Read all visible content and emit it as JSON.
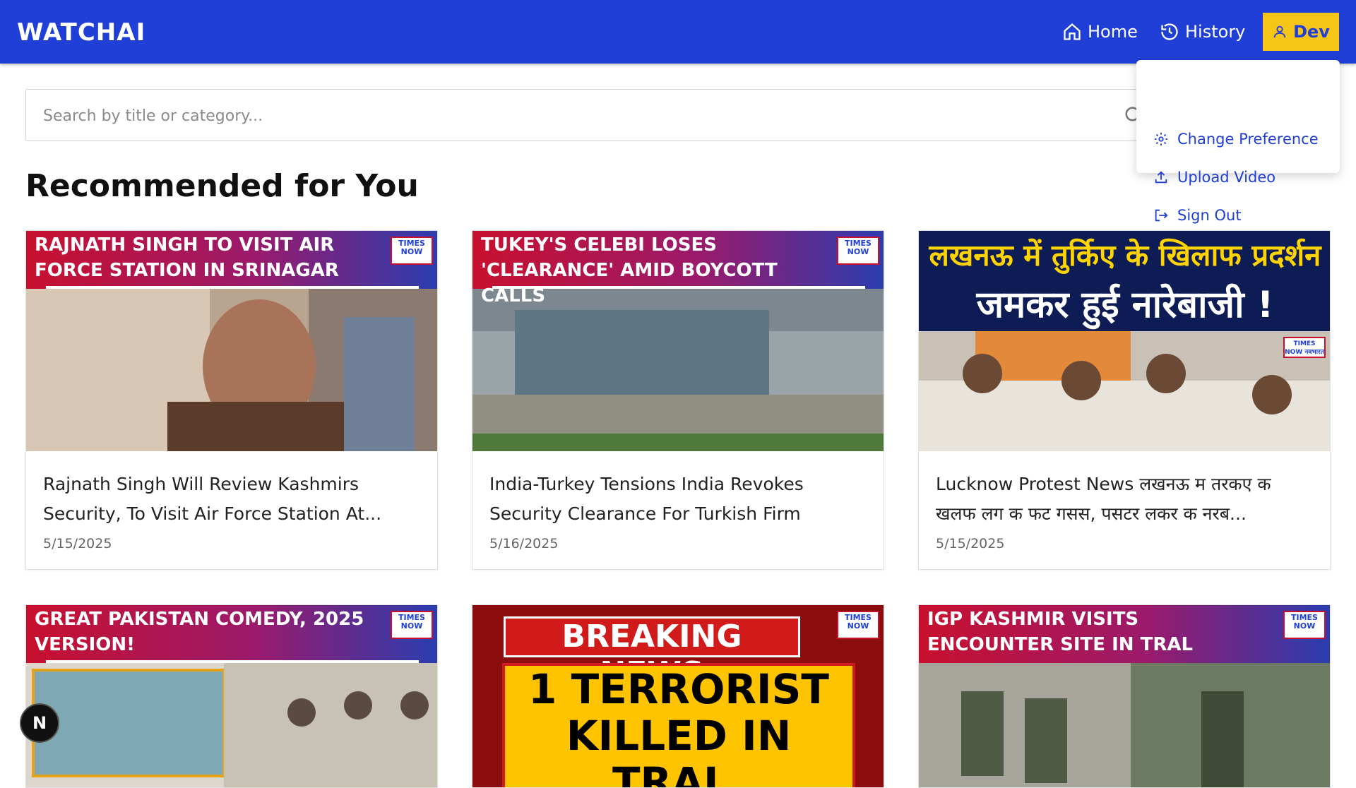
{
  "app": {
    "title": "WATCHAI"
  },
  "nav": {
    "home": "Home",
    "history": "History",
    "user": "Dev"
  },
  "user_menu": {
    "items": [
      {
        "label": "Change Preference",
        "icon": "gear-icon"
      },
      {
        "label": "Upload Video",
        "icon": "upload-icon"
      },
      {
        "label": "Sign Out",
        "icon": "sign-out-icon"
      }
    ]
  },
  "search": {
    "placeholder": "Search by title or category...",
    "value": ""
  },
  "section": {
    "title": "Recommended for You"
  },
  "videos": [
    {
      "thumb_headline": "RAJNATH SINGH TO VISIT AIR FORCE STATION IN SRINAGAR",
      "channel_badge": "TIMES NOW",
      "title": "Rajnath Singh Will Review Kashmirs Security, To Visit Air Force Station At...",
      "date": "5/15/2025"
    },
    {
      "thumb_headline": "TUKEY'S CELEBI LOSES 'CLEARANCE' AMID BOYCOTT CALLS",
      "channel_badge": "TIMES NOW",
      "title": "India-Turkey Tensions India Revokes Security Clearance For Turkish Firm Celebi...",
      "date": "5/16/2025"
    },
    {
      "thumb_headline_line1": "लखनऊ में तुर्किए के खिलाफ प्रदर्शन",
      "thumb_headline_line2": "जमकर हुई नारेबाजी !",
      "channel_badge": "TIMES NOW नवभारत",
      "title": "Lucknow Protest News लखनऊ म तरकए क खलफ लग क फट गसस, पसटर लकर क नरब...",
      "date": "5/15/2025"
    },
    {
      "thumb_headline": "GREAT PAKISTAN COMEDY, 2025 VERSION!",
      "channel_badge": "TIMES NOW"
    },
    {
      "thumb_label": "BREAKING NEWS",
      "thumb_headline_line1": "1 TERRORIST",
      "thumb_headline_line2": "KILLED IN TRAL,",
      "channel_badge": "TIMES NOW"
    },
    {
      "thumb_headline": "IGP KASHMIR VISITS ENCOUNTER SITE IN TRAL",
      "channel_badge": "TIMES NOW"
    }
  ],
  "floating_button": {
    "label": "N"
  },
  "colors": {
    "header": "#1f3fd6",
    "accent": "#f5c518",
    "link": "#1f3fd6"
  }
}
